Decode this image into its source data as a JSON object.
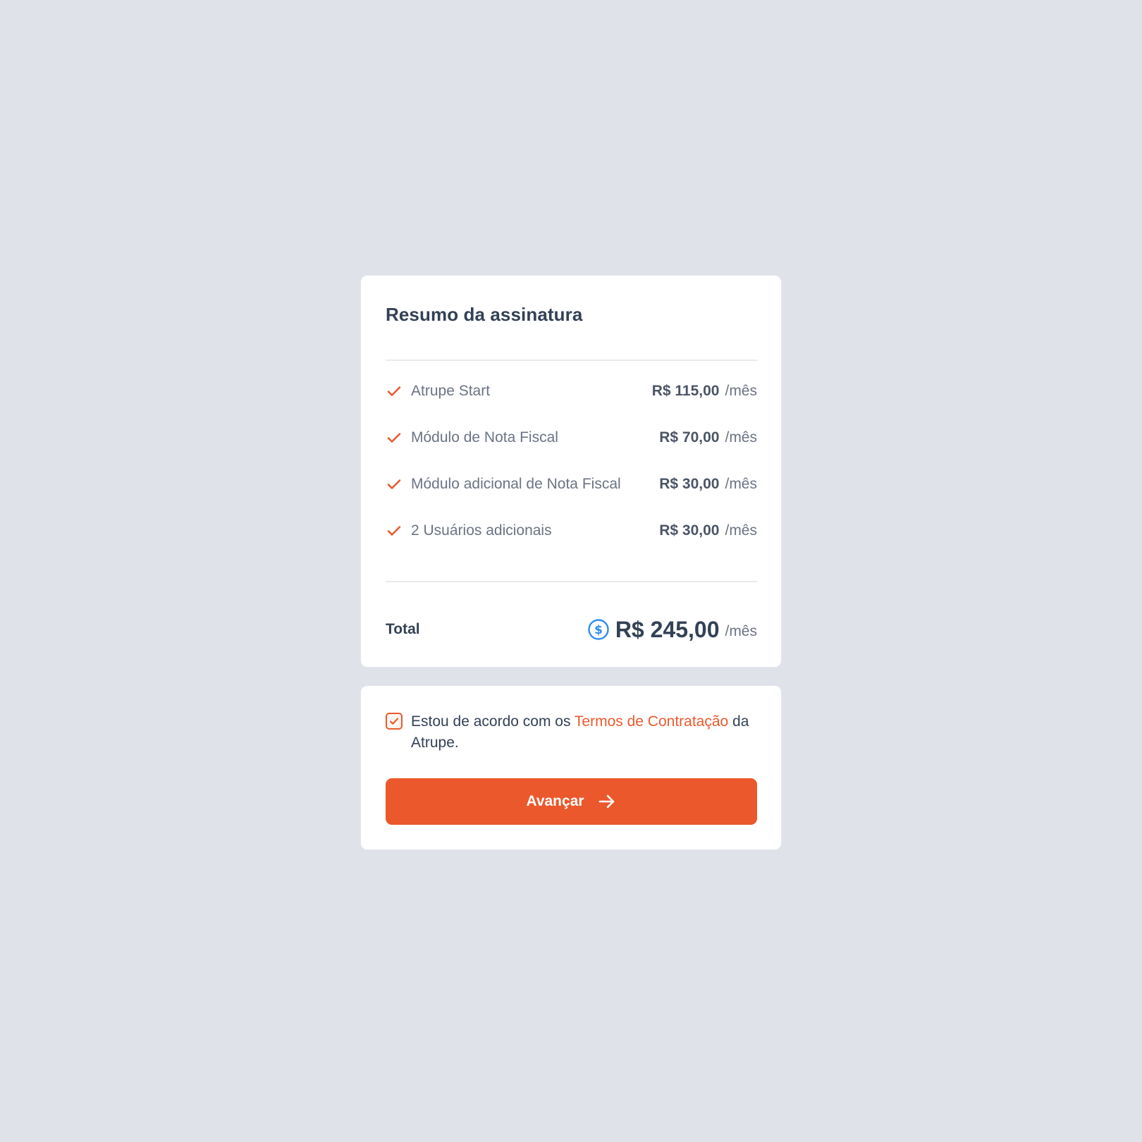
{
  "summary": {
    "title": "Resumo da assinatura",
    "items": [
      {
        "label": "Atrupe Start",
        "price": "R$ 115,00",
        "period": "/mês"
      },
      {
        "label": "Módulo de Nota Fiscal",
        "price": "R$ 70,00",
        "period": "/mês"
      },
      {
        "label": "Módulo adicional de Nota Fiscal",
        "price": "R$ 30,00",
        "period": "/mês"
      },
      {
        "label": "2 Usuários adicionais",
        "price": "R$ 30,00",
        "period": "/mês"
      }
    ],
    "total": {
      "label": "Total",
      "value": "R$ 245,00",
      "period": "/mês",
      "icon": "dollar-circle-icon"
    }
  },
  "terms": {
    "checked": true,
    "text_before": "Estou de acordo com os ",
    "link_text": "Termos de Contratação",
    "text_after": " da Atrupe."
  },
  "actions": {
    "advance_label": "Avançar",
    "advance_icon": "arrow-right-icon"
  },
  "colors": {
    "accent": "#eb582b",
    "dollar_icon": "#2f8cf0",
    "background": "#dfe2e9",
    "card": "#ffffff",
    "text_dark": "#334155",
    "text_muted": "#6b7383"
  }
}
